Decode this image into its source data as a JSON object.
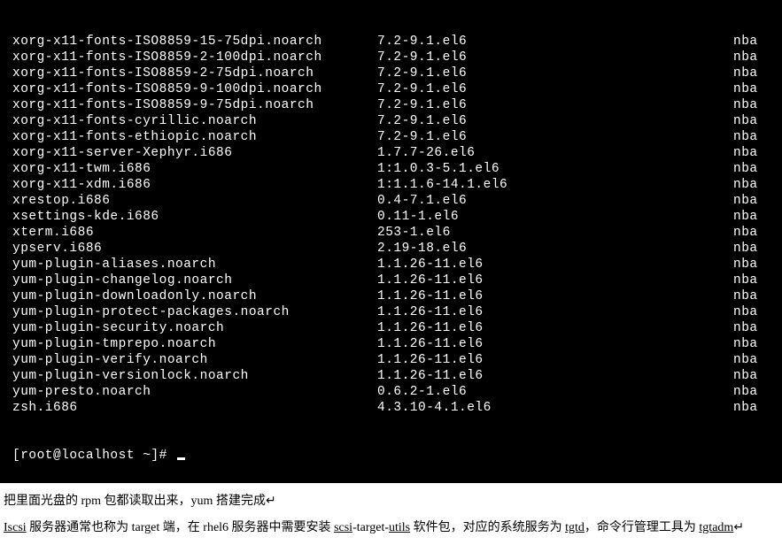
{
  "terminal": {
    "rows": [
      {
        "pkg": "xorg-x11-fonts-ISO8859-15-75dpi.noarch",
        "ver": "7.2-9.1.el6",
        "repo": "nba"
      },
      {
        "pkg": "xorg-x11-fonts-ISO8859-2-100dpi.noarch",
        "ver": "7.2-9.1.el6",
        "repo": "nba"
      },
      {
        "pkg": "xorg-x11-fonts-ISO8859-2-75dpi.noarch",
        "ver": "7.2-9.1.el6",
        "repo": "nba"
      },
      {
        "pkg": "xorg-x11-fonts-ISO8859-9-100dpi.noarch",
        "ver": "7.2-9.1.el6",
        "repo": "nba"
      },
      {
        "pkg": "xorg-x11-fonts-ISO8859-9-75dpi.noarch",
        "ver": "7.2-9.1.el6",
        "repo": "nba"
      },
      {
        "pkg": "xorg-x11-fonts-cyrillic.noarch",
        "ver": "7.2-9.1.el6",
        "repo": "nba"
      },
      {
        "pkg": "xorg-x11-fonts-ethiopic.noarch",
        "ver": "7.2-9.1.el6",
        "repo": "nba"
      },
      {
        "pkg": "xorg-x11-server-Xephyr.i686",
        "ver": "1.7.7-26.el6",
        "repo": "nba"
      },
      {
        "pkg": "xorg-x11-twm.i686",
        "ver": "1:1.0.3-5.1.el6",
        "repo": "nba"
      },
      {
        "pkg": "xorg-x11-xdm.i686",
        "ver": "1:1.1.6-14.1.el6",
        "repo": "nba"
      },
      {
        "pkg": "xrestop.i686",
        "ver": "0.4-7.1.el6",
        "repo": "nba"
      },
      {
        "pkg": "xsettings-kde.i686",
        "ver": "0.11-1.el6",
        "repo": "nba"
      },
      {
        "pkg": "xterm.i686",
        "ver": "253-1.el6",
        "repo": "nba"
      },
      {
        "pkg": "ypserv.i686",
        "ver": "2.19-18.el6",
        "repo": "nba"
      },
      {
        "pkg": "yum-plugin-aliases.noarch",
        "ver": "1.1.26-11.el6",
        "repo": "nba"
      },
      {
        "pkg": "yum-plugin-changelog.noarch",
        "ver": "1.1.26-11.el6",
        "repo": "nba"
      },
      {
        "pkg": "yum-plugin-downloadonly.noarch",
        "ver": "1.1.26-11.el6",
        "repo": "nba"
      },
      {
        "pkg": "yum-plugin-protect-packages.noarch",
        "ver": "1.1.26-11.el6",
        "repo": "nba"
      },
      {
        "pkg": "yum-plugin-security.noarch",
        "ver": "1.1.26-11.el6",
        "repo": "nba"
      },
      {
        "pkg": "yum-plugin-tmprepo.noarch",
        "ver": "1.1.26-11.el6",
        "repo": "nba"
      },
      {
        "pkg": "yum-plugin-verify.noarch",
        "ver": "1.1.26-11.el6",
        "repo": "nba"
      },
      {
        "pkg": "yum-plugin-versionlock.noarch",
        "ver": "1.1.26-11.el6",
        "repo": "nba"
      },
      {
        "pkg": "yum-presto.noarch",
        "ver": "0.6.2-1.el6",
        "repo": "nba"
      },
      {
        "pkg": "zsh.i686",
        "ver": "4.3.10-4.1.el6",
        "repo": "nba"
      }
    ],
    "prompt": "[root@localhost ~]# "
  },
  "doc": {
    "line1_a": "把里面光盘的 rpm 包都读取出来，yum 搭建完成",
    "line2_kw1": "Iscsi",
    "line2_a": " 服务器通常也称为 target 端，在 rhel6 服务器中需要安装 ",
    "line2_kw2": "scsi",
    "line2_b": "-target-",
    "line2_kw3": "utils",
    "line2_c": " 软件包，对应的系统服务为 ",
    "line2_kw4": "tgtd",
    "line2_d": "，命令行管理工具为 ",
    "line2_kw5": "tgtadm",
    "tail": "↵"
  }
}
